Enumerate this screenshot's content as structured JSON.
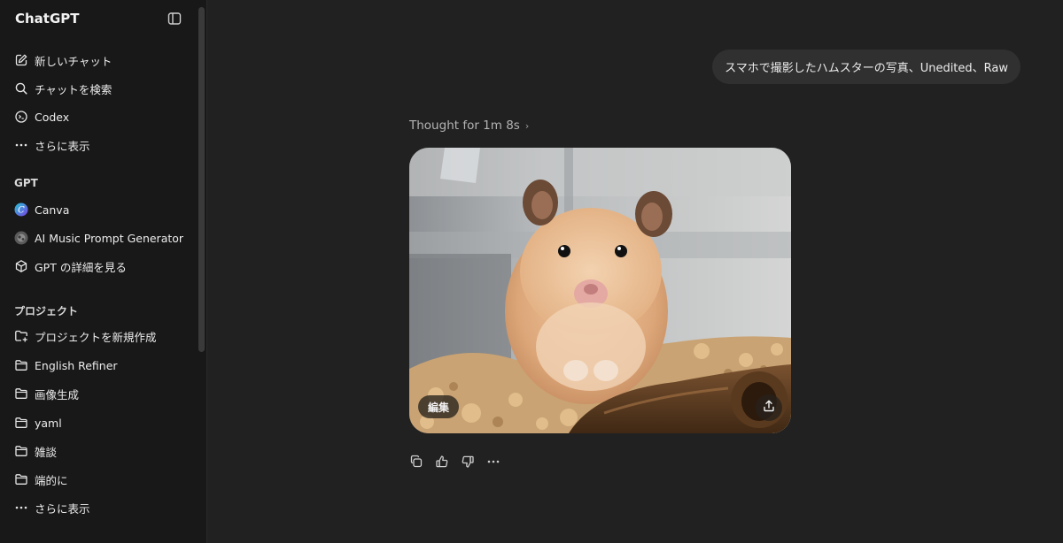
{
  "app": {
    "title": "ChatGPT"
  },
  "sidebar": {
    "top_items": [
      {
        "label": "新しいチャット",
        "icon": "edit-icon"
      },
      {
        "label": "チャットを検索",
        "icon": "search-icon"
      },
      {
        "label": "Codex",
        "icon": "codex-icon"
      },
      {
        "label": "さらに表示",
        "icon": "more-icon"
      }
    ],
    "gpt_section": {
      "title": "GPT",
      "items": [
        {
          "label": "Canva",
          "icon": "canva-icon"
        },
        {
          "label": "AI Music Prompt Generator",
          "icon": "music-gpt-icon"
        },
        {
          "label": "GPT の詳細を見る",
          "icon": "cube-icon"
        }
      ]
    },
    "project_section": {
      "title": "プロジェクト",
      "items": [
        {
          "label": "プロジェクトを新規作成",
          "icon": "new-folder-icon"
        },
        {
          "label": "English Refiner",
          "icon": "folder-icon"
        },
        {
          "label": "画像生成",
          "icon": "folder-icon"
        },
        {
          "label": "yaml",
          "icon": "folder-icon"
        },
        {
          "label": "雑談",
          "icon": "folder-icon"
        },
        {
          "label": "端的に",
          "icon": "folder-icon"
        },
        {
          "label": "さらに表示",
          "icon": "more-icon"
        }
      ]
    }
  },
  "conversation": {
    "user_message": "スマホで撮影したハムスターの写真、Unedited、Raw",
    "thought_label": "Thought for 1m 8s",
    "image": {
      "subject": "hamster photo",
      "edit_label": "編集"
    },
    "actions": [
      "copy-icon",
      "thumbs-up-icon",
      "thumbs-down-icon",
      "more-icon"
    ]
  },
  "colors": {
    "background": "#212121",
    "sidebar": "#181818",
    "bubble": "#303030",
    "text": "#ececec",
    "muted": "#b4b4b4"
  }
}
